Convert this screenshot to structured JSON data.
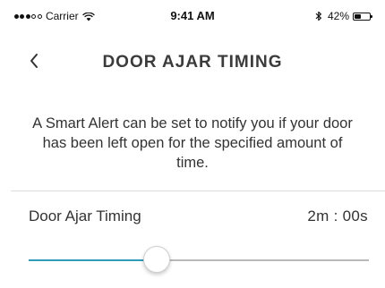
{
  "status_bar": {
    "signal_bars_filled": 3,
    "signal_bars_total": 5,
    "carrier": "Carrier",
    "time": "9:41 AM",
    "battery_percent": "42%",
    "battery_level": 0.42,
    "icons": [
      "wifi-icon",
      "bluetooth-icon",
      "battery-icon"
    ]
  },
  "nav": {
    "back_icon": "chevron-left-icon",
    "title": "DOOR AJAR TIMING"
  },
  "description": "A Smart Alert can be set to notify you if your door has been left open for the specified amount of time.",
  "setting": {
    "label": "Door Ajar Timing",
    "value": "2m : 00s"
  },
  "slider": {
    "fraction": 0.376,
    "fill_color": "#2f9bb8",
    "track_color": "#b9b9b9"
  }
}
